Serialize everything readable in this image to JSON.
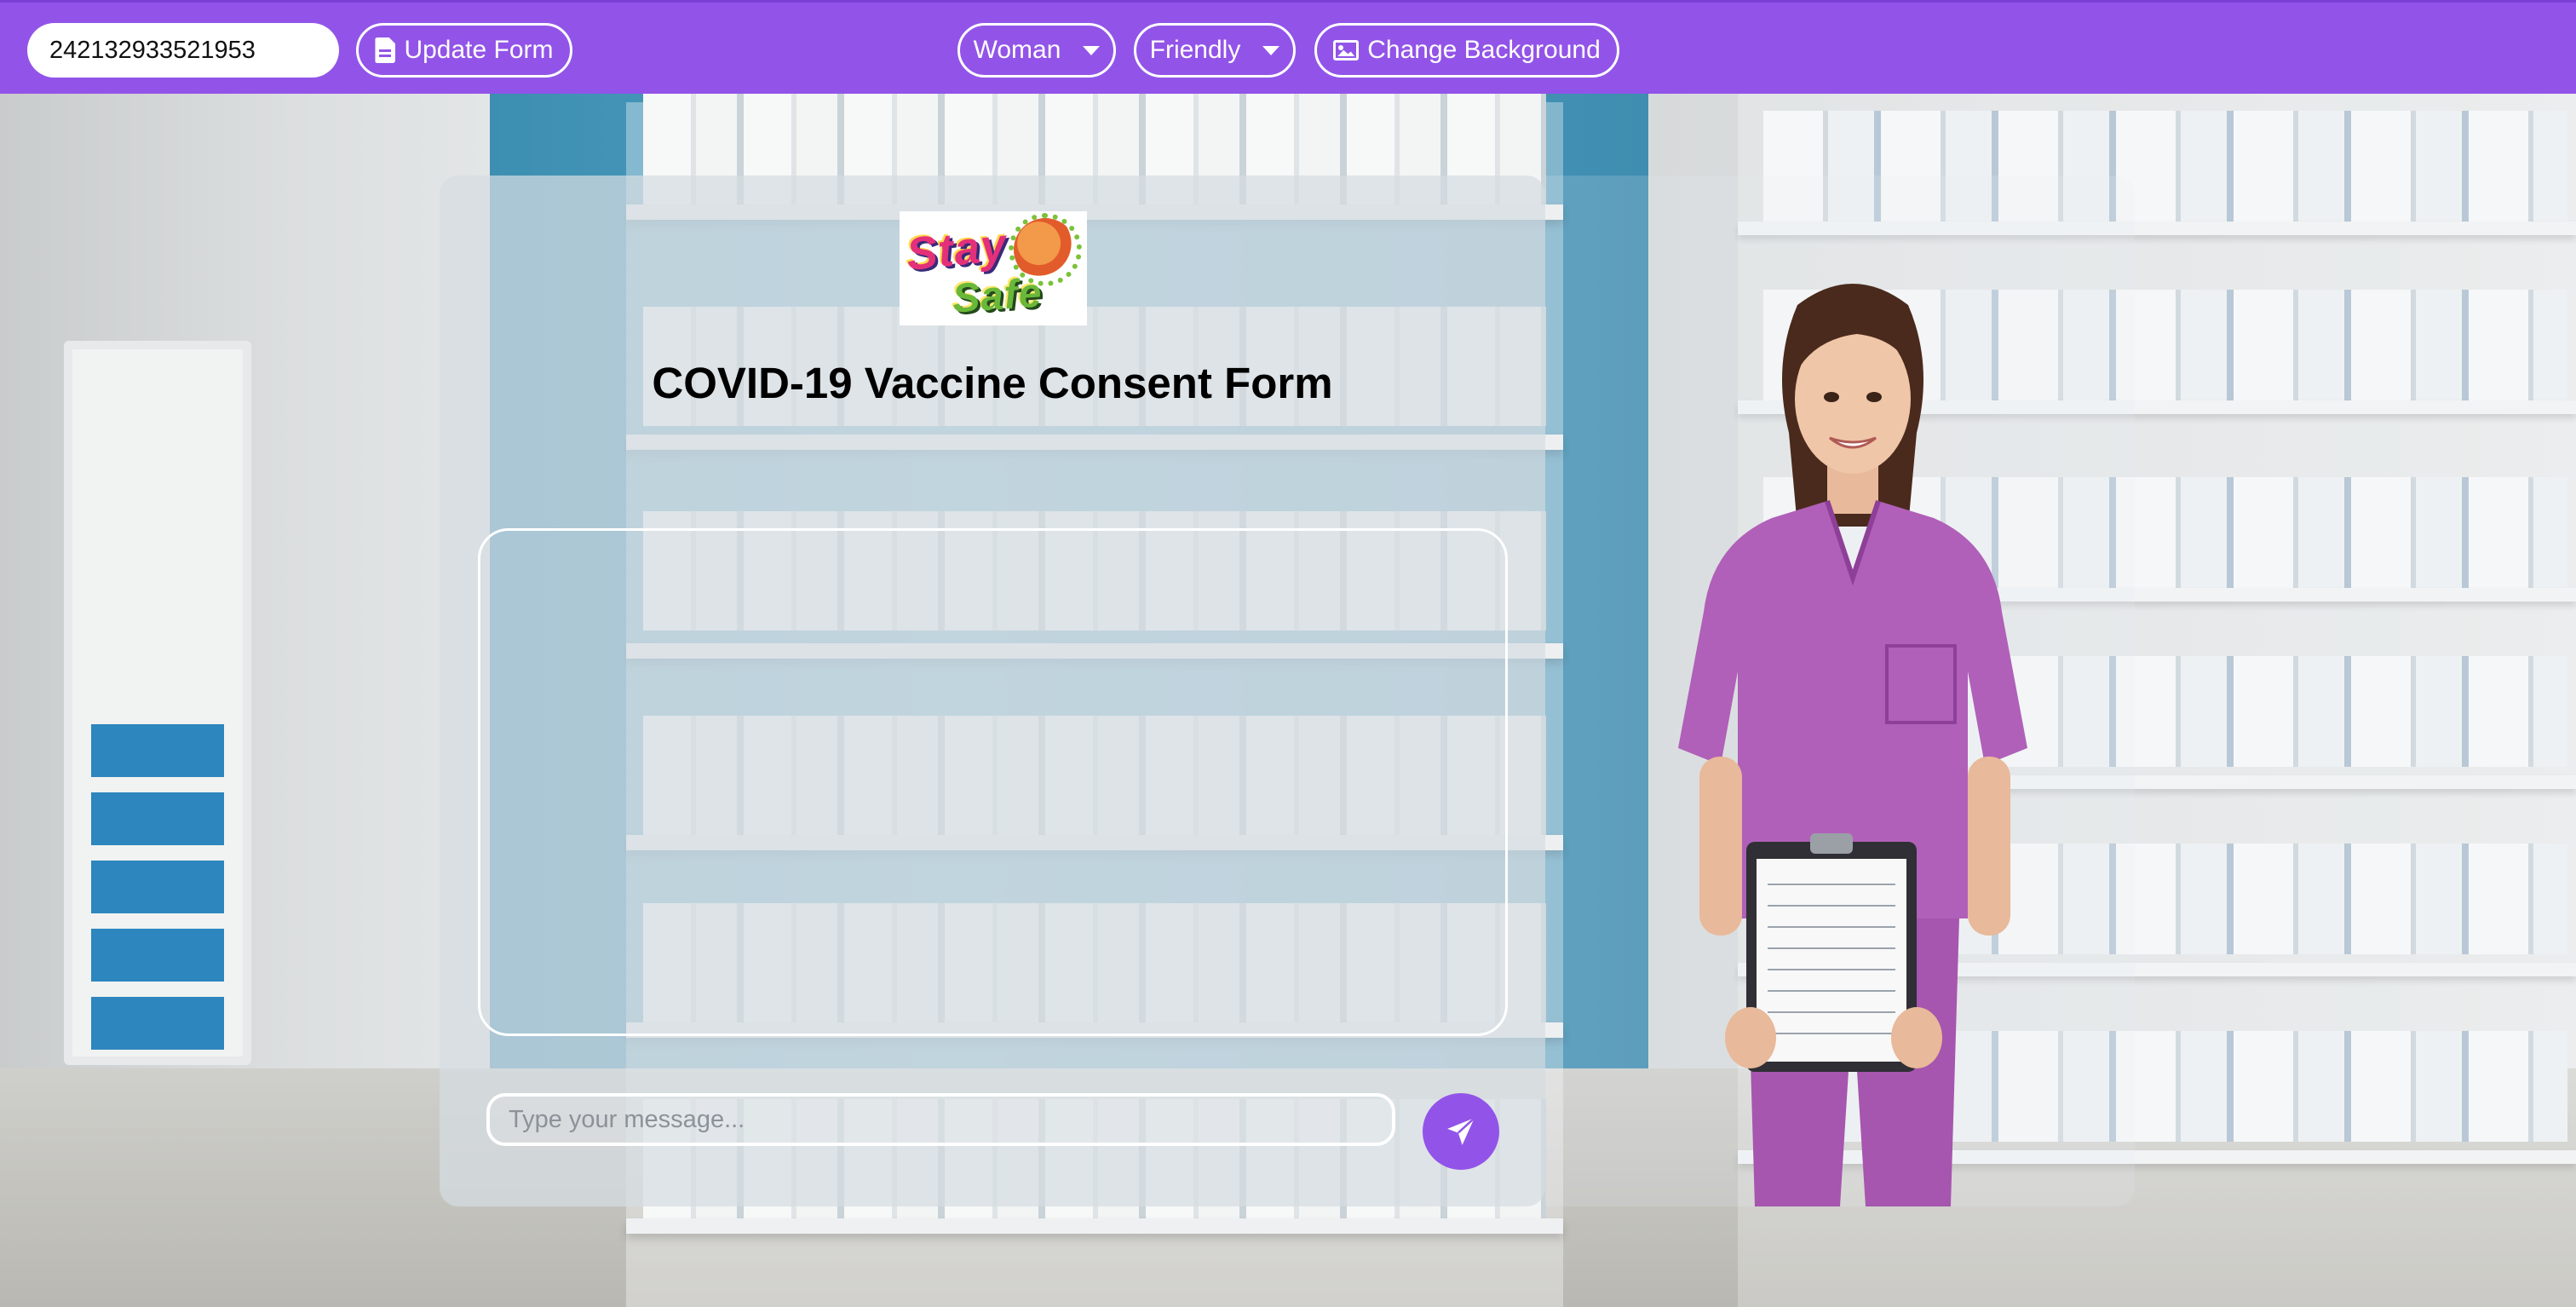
{
  "topbar": {
    "id_value": "242132933521953",
    "update_form_label": "Update Form",
    "gender_select": "Woman",
    "tone_select": "Friendly",
    "change_background_label": "Change Background"
  },
  "logo": {
    "line1": "Stay",
    "line2": "Safe"
  },
  "main": {
    "title": "COVID-19 Vaccine Consent Form",
    "message_placeholder": "Type your message..."
  },
  "colors": {
    "accent": "#9254e8",
    "card": "#d6dce2"
  },
  "icons": {
    "update_form": "document-icon",
    "change_background": "image-icon",
    "send": "paper-plane-icon",
    "dropdown": "caret-down-icon"
  }
}
